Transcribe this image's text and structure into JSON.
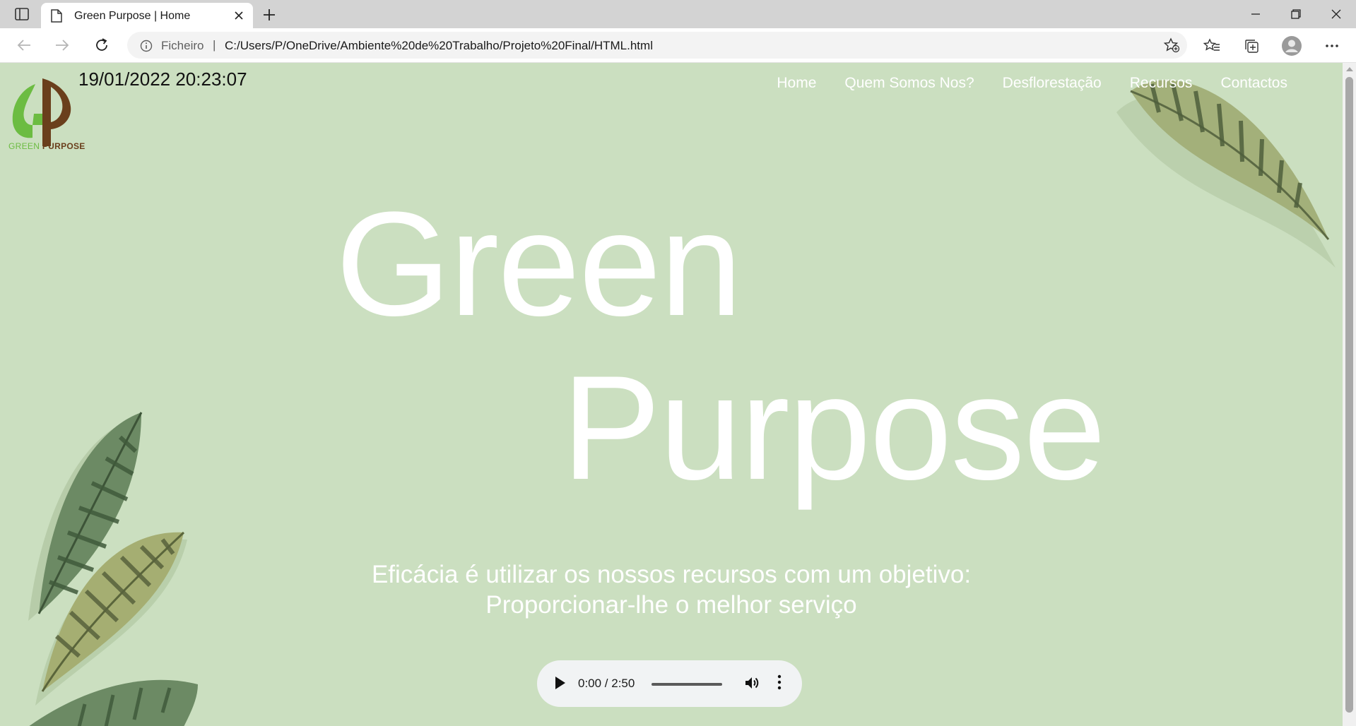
{
  "browser": {
    "tab": {
      "title": "Green Purpose | Home"
    },
    "address": {
      "scheme_label": "Ficheiro",
      "separator": "|",
      "url": "C:/Users/P/OneDrive/Ambiente%20de%20Trabalho/Projeto%20Final/HTML.html"
    }
  },
  "page": {
    "logo_text_green": "GREEN",
    "logo_text_purpose": "PURPOSE",
    "clock": "19/01/2022 20:23:07",
    "nav": [
      "Home",
      "Quem Somos Nos?",
      "Desflorestação",
      "Recursos",
      "Contactos"
    ],
    "hero_line1": "Green",
    "hero_line2": "Purpose",
    "tagline_line1": "Eficácia é utilizar os nossos recursos com um objetivo:",
    "tagline_line2": "Proporcionar-lhe o melhor serviço",
    "audio": {
      "time": "0:00 / 2:50"
    }
  },
  "colors": {
    "page_background": "#cbdfc0",
    "logo_green": "#6cbc42",
    "logo_brown": "#6a3f1c",
    "text_white": "#ffffff"
  }
}
